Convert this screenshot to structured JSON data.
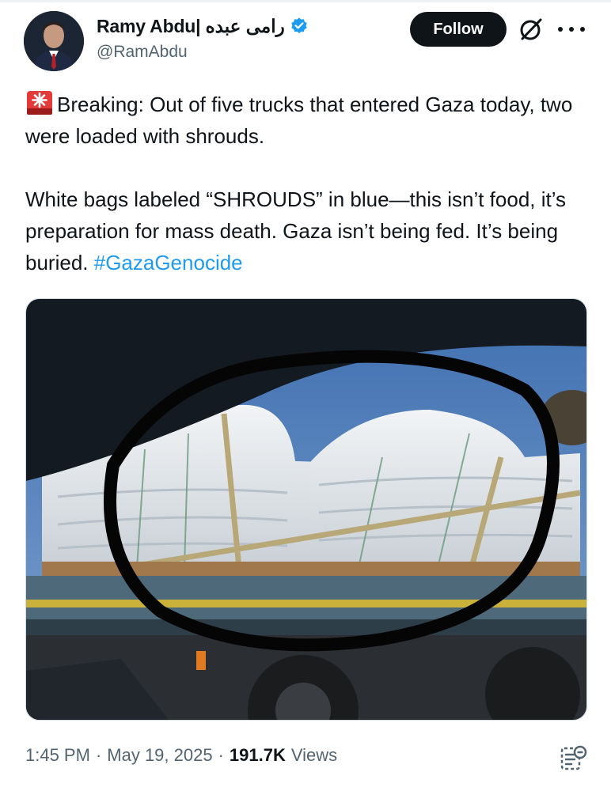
{
  "author": {
    "display_name": "Ramy Abdu| رامى عبده",
    "handle": "@RamAbdu",
    "verified": true,
    "avatar": "profile-photo"
  },
  "header": {
    "follow_label": "Follow",
    "grok_icon": "grok-icon",
    "more_icon": "more-icon"
  },
  "tweet": {
    "emoji": "rotating-light-emoji",
    "paragraph1": "Breaking: Out of five trucks that entered Gaza today, two were loaded with shrouds.",
    "paragraph2_text": "White bags labeled “SHROUDS” in blue—this isn’t food, it’s preparation for mass death. Gaza isn’t being fed. It’s being buried.",
    "hashtag": "#GazaGenocide"
  },
  "media": {
    "type": "photo",
    "subject": "truck loaded with white bags, circled in black marker"
  },
  "meta": {
    "time": "1:45 PM",
    "separator": "·",
    "date": "May 19, 2025",
    "views_count": "191.7K",
    "views_label": "Views"
  },
  "colors": {
    "text": "#0f1419",
    "secondary": "#536471",
    "link": "#1d9bf0",
    "verified": "#1d9bf0",
    "button_bg": "#0f1419"
  }
}
